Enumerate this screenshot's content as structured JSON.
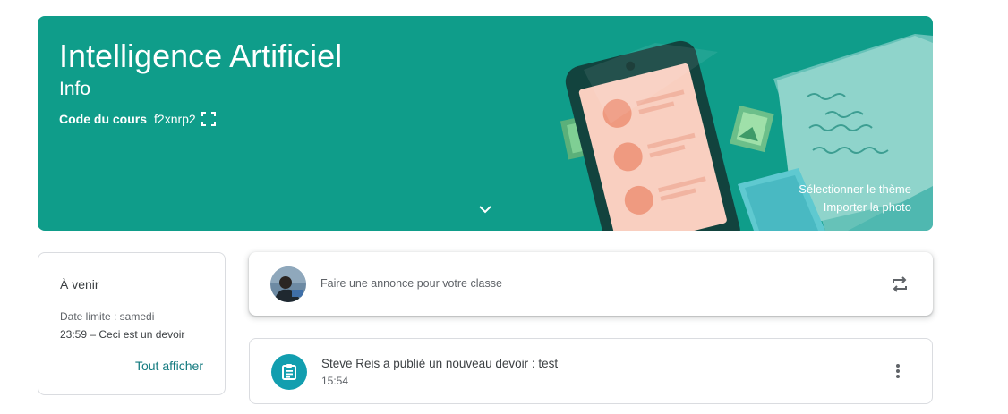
{
  "banner": {
    "title": "Intelligence Artificiel",
    "section": "Info",
    "code_label": "Code du cours",
    "code_value": "f2xnrp2",
    "select_theme": "Sélectionner le thème",
    "upload_photo": "Importer la photo",
    "color": "#0f9d8a",
    "icons": [
      "fullscreen-icon",
      "chevron-down-icon"
    ]
  },
  "upcoming": {
    "title": "À venir",
    "due_label": "Date limite : samedi",
    "items": [
      "23:59 – Ceci est un devoir"
    ],
    "view_all": "Tout afficher"
  },
  "announce": {
    "placeholder": "Faire une annonce pour votre classe",
    "icons": [
      "avatar",
      "repost-icon"
    ]
  },
  "stream": [
    {
      "title": "Steve Reis a publié un nouveau devoir : test",
      "time": "15:54",
      "icon": "assignment-icon",
      "icon_color": "#129eaf"
    }
  ],
  "accent_color": "#137a7f"
}
